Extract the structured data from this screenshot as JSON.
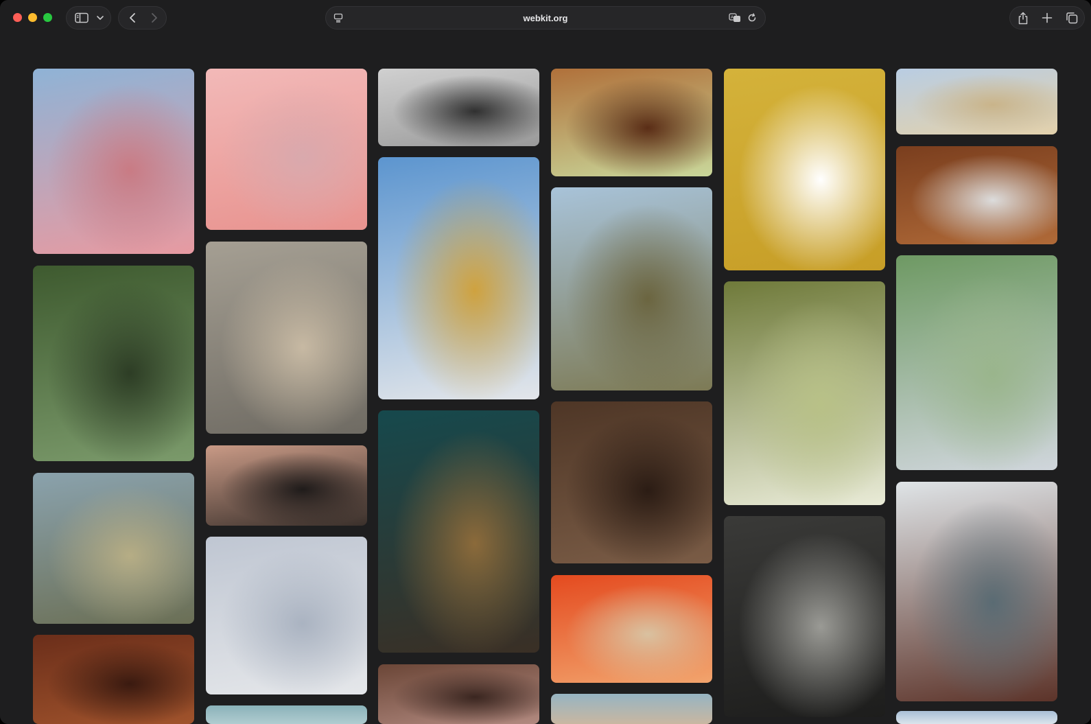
{
  "browser": {
    "url": "webkit.org",
    "icons": {
      "sidebar": "sidebar-icon",
      "chevron": "chevron-down-icon",
      "back": "back-arrow-icon",
      "forward": "forward-arrow-icon",
      "page_menu": "page-menu-icon",
      "translate": "translate-icon",
      "reload": "reload-icon",
      "share": "share-icon",
      "new_tab": "plus-icon",
      "tabs_overview": "tabs-overview-icon"
    }
  },
  "gallery": {
    "images": [
      {
        "name": "pink-hotel-photo",
        "colors": [
          "#8fb3d6",
          "#e79aa1",
          "#c97b84"
        ]
      },
      {
        "name": "waterfall-photo",
        "colors": [
          "#3e5a2f",
          "#7b9a6b",
          "#2d3d25"
        ]
      },
      {
        "name": "daisies-sea-photo",
        "colors": [
          "#8aa2ad",
          "#6b6f55",
          "#b6ad85"
        ]
      },
      {
        "name": "wooden-ceiling-photo",
        "colors": [
          "#6b2e1a",
          "#a0532c",
          "#3a1a10"
        ]
      },
      {
        "name": "pink-flower-photo",
        "colors": [
          "#f2b9b8",
          "#e8938f",
          "#d9a9ad"
        ]
      },
      {
        "name": "ocean-wave-photo",
        "colors": [
          "#a59f93",
          "#6f6b63",
          "#c7b9a3"
        ]
      },
      {
        "name": "mountain-sunset-photo",
        "colors": [
          "#c99a86",
          "#3a302b",
          "#1f1b1a"
        ]
      },
      {
        "name": "white-wall-photo",
        "colors": [
          "#bfc6d2",
          "#e5e7ea",
          "#aab3c1"
        ]
      },
      {
        "name": "ocean-strip-photo",
        "colors": [
          "#8ab2b9",
          "#b0ccd0"
        ]
      },
      {
        "name": "hill-chapel-photo",
        "colors": [
          "#d0d0d0",
          "#9a9a9a",
          "#303030"
        ]
      },
      {
        "name": "white-building-photo",
        "colors": [
          "#5c95cf",
          "#e3e6ea",
          "#cfa23f"
        ]
      },
      {
        "name": "candles-interior-photo",
        "colors": [
          "#16494d",
          "#3a2f25",
          "#8b6a3a"
        ]
      },
      {
        "name": "arches-photo",
        "colors": [
          "#6b4637",
          "#b28a80",
          "#3a2620"
        ]
      },
      {
        "name": "cafe-chairs-photo",
        "colors": [
          "#b0703a",
          "#c9d79a",
          "#5a2d16"
        ]
      },
      {
        "name": "mine-ruin-photo",
        "colors": [
          "#a8c3d9",
          "#7d7a55",
          "#6b6540"
        ]
      },
      {
        "name": "tree-bark-photo",
        "colors": [
          "#4e3626",
          "#7a5c46",
          "#2b1c14"
        ]
      },
      {
        "name": "orange-abstract-photo",
        "colors": [
          "#e44a1f",
          "#f2a46d",
          "#d9c1a0"
        ]
      },
      {
        "name": "beach-strip-photo",
        "colors": [
          "#96b4c2",
          "#c9b7a1"
        ]
      },
      {
        "name": "yellow-plant-photo",
        "colors": [
          "#d4b23a",
          "#c79e27",
          "#ffffff"
        ]
      },
      {
        "name": "white-hydrangea-photo",
        "colors": [
          "#6f7a3a",
          "#e9ebd7",
          "#b8c187"
        ]
      },
      {
        "name": "dark-office-photo",
        "colors": [
          "#3a3a38",
          "#1d1d1c",
          "#9a9a95"
        ]
      },
      {
        "name": "sand-dune-photo",
        "colors": [
          "#b9cde3",
          "#e3d1ab",
          "#c9b48a"
        ]
      },
      {
        "name": "wooden-door-photo",
        "colors": [
          "#7a3e1e",
          "#b06a38",
          "#dcdcdc"
        ]
      },
      {
        "name": "green-house-photo",
        "colors": [
          "#6e9963",
          "#d0d6dc",
          "#9ab58c"
        ]
      },
      {
        "name": "manhattan-bridge-photo",
        "colors": [
          "#dfe4e7",
          "#5c3329",
          "#5a6b73"
        ]
      },
      {
        "name": "blue-strip-photo",
        "colors": [
          "#a9bfd6",
          "#dbe4ec"
        ]
      }
    ]
  }
}
